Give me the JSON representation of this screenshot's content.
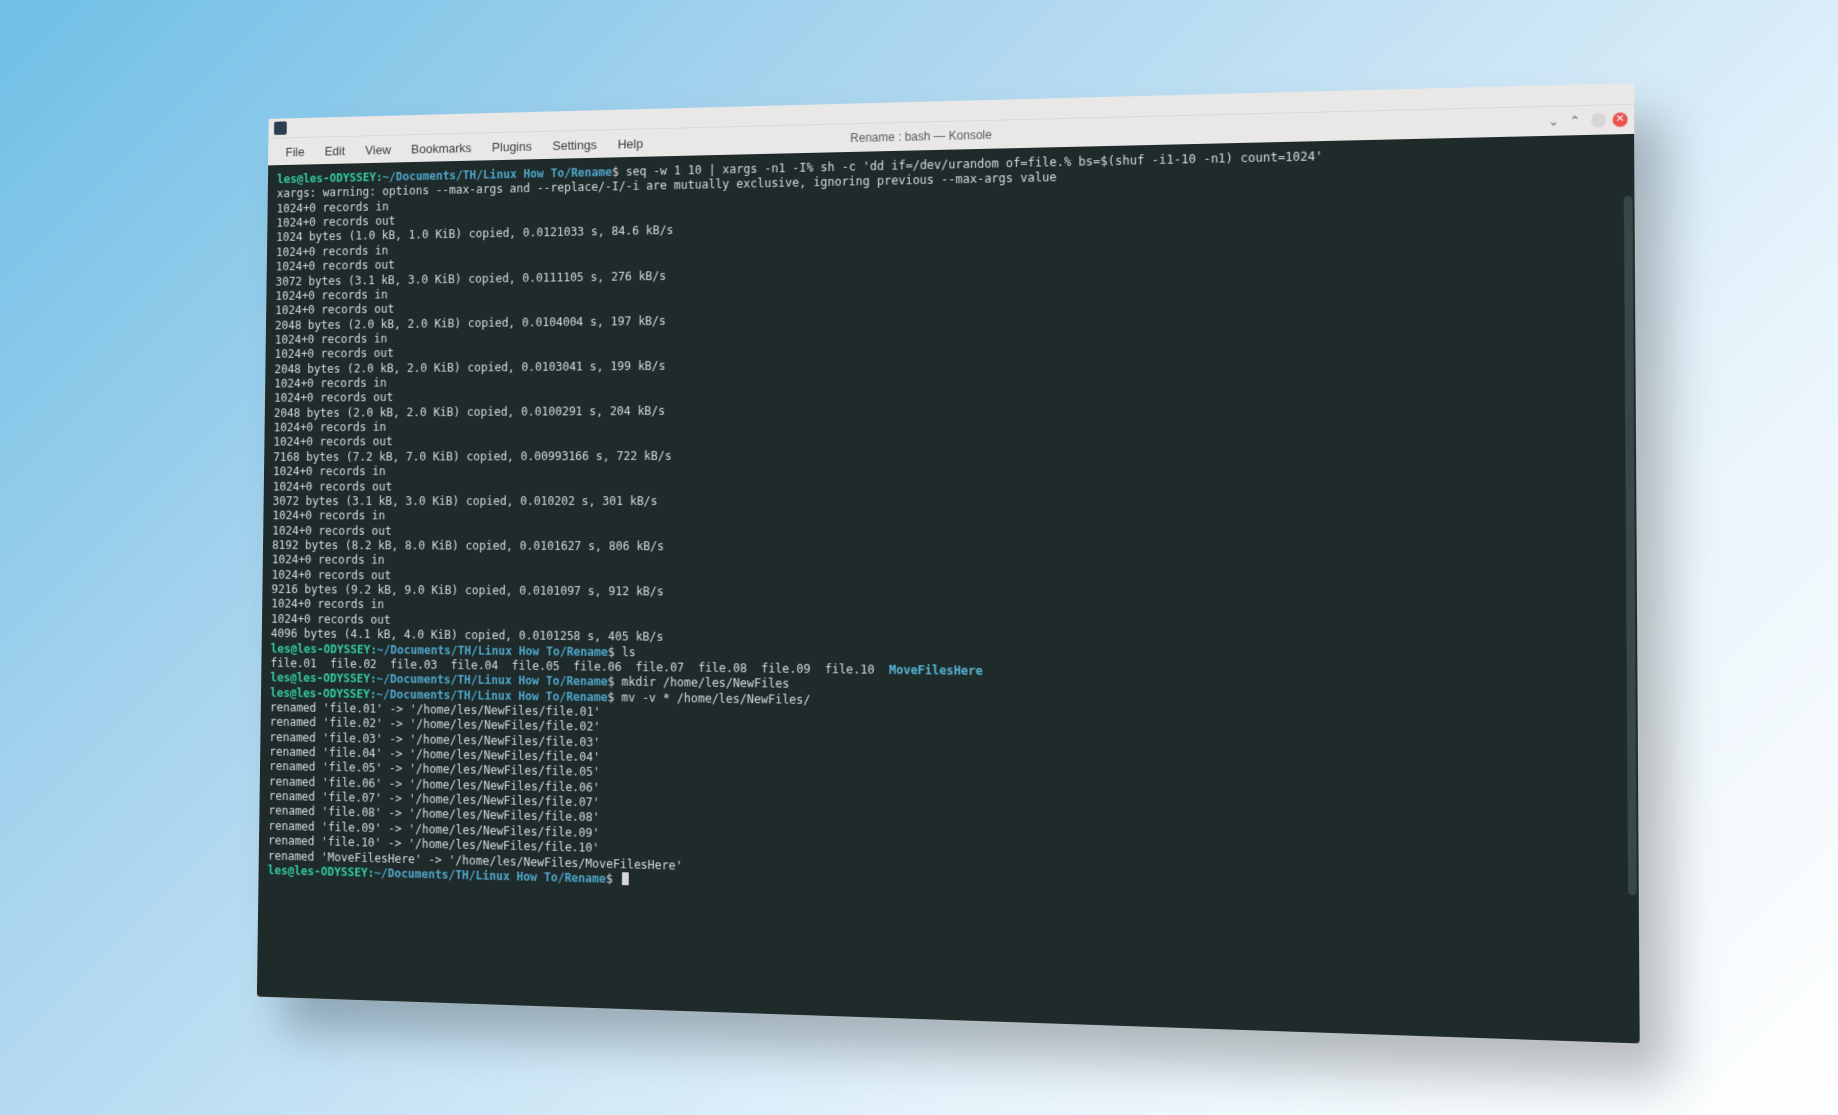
{
  "window_title": "Rename : bash — Konsole",
  "menu": [
    "File",
    "Edit",
    "View",
    "Bookmarks",
    "Plugins",
    "Settings",
    "Help"
  ],
  "prompt_user": "les@les-ODYSSEY",
  "prompt_path": "~/Documents/TH/Linux How To/Rename",
  "cmd1": "seq -w 1 10 | xargs -n1 -I% sh -c 'dd if=/dev/urandom of=file.% bs=$(shuf -i1-10 -n1) count=1024'",
  "xargs_warn": "xargs: warning: options --max-args and --replace/-I/-i are mutually exclusive, ignoring previous --max-args value",
  "dd": [
    [
      "1024 bytes (1.0 kB, 1.0 KiB) copied, 0.0121033 s, 84.6 kB/s"
    ],
    [
      "3072 bytes (3.1 kB, 3.0 KiB) copied, 0.0111105 s, 276 kB/s"
    ],
    [
      "2048 bytes (2.0 kB, 2.0 KiB) copied, 0.0104004 s, 197 kB/s"
    ],
    [
      "2048 bytes (2.0 kB, 2.0 KiB) copied, 0.0103041 s, 199 kB/s"
    ],
    [
      "2048 bytes (2.0 kB, 2.0 KiB) copied, 0.0100291 s, 204 kB/s"
    ],
    [
      "7168 bytes (7.2 kB, 7.0 KiB) copied, 0.00993166 s, 722 kB/s"
    ],
    [
      "3072 bytes (3.1 kB, 3.0 KiB) copied, 0.010202 s, 301 kB/s"
    ],
    [
      "8192 bytes (8.2 kB, 8.0 KiB) copied, 0.0101627 s, 806 kB/s"
    ],
    [
      "9216 bytes (9.2 kB, 9.0 KiB) copied, 0.0101097 s, 912 kB/s"
    ],
    [
      "4096 bytes (4.1 kB, 4.0 KiB) copied, 0.0101258 s, 405 kB/s"
    ]
  ],
  "rec_in": "1024+0 records in",
  "rec_out": "1024+0 records out",
  "cmd2": "ls",
  "ls_files": "file.01  file.02  file.03  file.04  file.05  file.06  file.07  file.08  file.09  file.10  ",
  "ls_dir": "MoveFilesHere",
  "cmd3": "mkdir /home/les/NewFiles",
  "cmd4": "mv -v * /home/les/NewFiles/",
  "mv": [
    "renamed 'file.01' -> '/home/les/NewFiles/file.01'",
    "renamed 'file.02' -> '/home/les/NewFiles/file.02'",
    "renamed 'file.03' -> '/home/les/NewFiles/file.03'",
    "renamed 'file.04' -> '/home/les/NewFiles/file.04'",
    "renamed 'file.05' -> '/home/les/NewFiles/file.05'",
    "renamed 'file.06' -> '/home/les/NewFiles/file.06'",
    "renamed 'file.07' -> '/home/les/NewFiles/file.07'",
    "renamed 'file.08' -> '/home/les/NewFiles/file.08'",
    "renamed 'file.09' -> '/home/les/NewFiles/file.09'",
    "renamed 'file.10' -> '/home/les/NewFiles/file.10'",
    "renamed 'MoveFilesHere' -> '/home/les/NewFiles/MoveFilesHere'"
  ]
}
